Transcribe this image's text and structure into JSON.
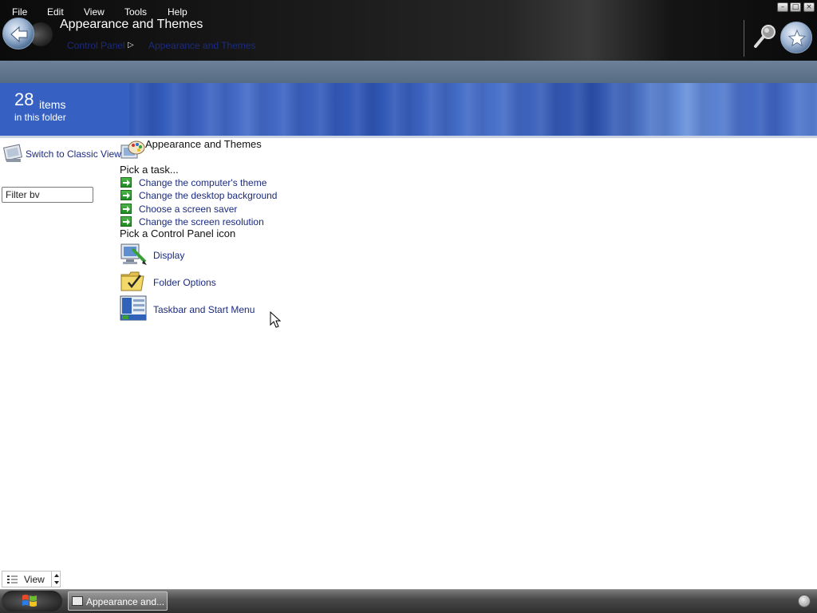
{
  "window": {
    "title": "Appearance and Themes",
    "breadcrumb": [
      "Control Panel",
      "Appearance and Themes"
    ],
    "controls": [
      "minimize",
      "maximize",
      "close"
    ]
  },
  "menubar": {
    "items": [
      "File",
      "Edit",
      "View",
      "Tools",
      "Help"
    ]
  },
  "banner": {
    "count": "28",
    "count_unit": "items",
    "subtitle": "in this folder"
  },
  "sidebar": {
    "classic_view_label": "Switch to Classic View",
    "filter_value": "Filter bv"
  },
  "main": {
    "category_title": "Appearance and Themes",
    "pick_task_heading": "Pick a task...",
    "tasks": [
      "Change the computer's theme",
      "Change the desktop background",
      "Choose a screen saver",
      "Change the screen resolution"
    ],
    "pick_icon_heading": "Pick a Control Panel icon",
    "icons": [
      {
        "label": "Display",
        "icon": "display-icon"
      },
      {
        "label": "Folder Options",
        "icon": "folder-options-icon"
      },
      {
        "label": "Taskbar and Start Menu",
        "icon": "taskbar-start-menu-icon"
      }
    ]
  },
  "footer": {
    "view_label": "View"
  },
  "taskbar": {
    "window_button_label": "Appearance and..."
  },
  "colors": {
    "link": "#1b2a80",
    "banner": "#2f56b8",
    "menubar": "#627890",
    "titlebar": "#111111"
  }
}
